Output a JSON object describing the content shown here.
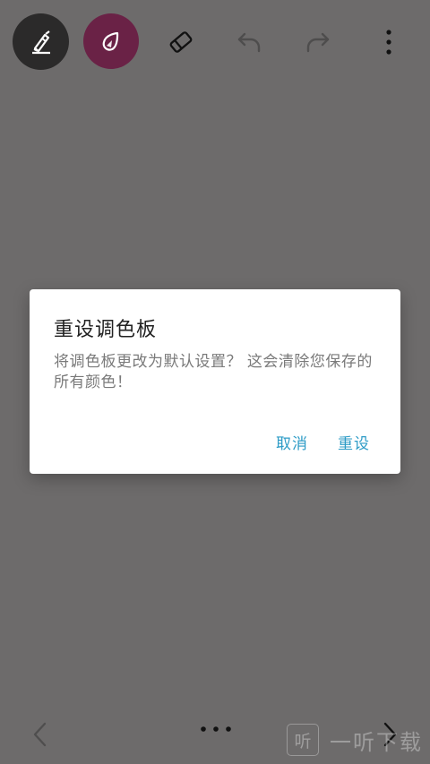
{
  "toolbar": {
    "tools": [
      {
        "name": "pen",
        "icon": "pen-icon",
        "color": "#2b2a2a"
      },
      {
        "name": "color",
        "icon": "droplet-icon",
        "color": "#6a2246"
      },
      {
        "name": "eraser",
        "icon": "eraser-icon"
      },
      {
        "name": "undo",
        "icon": "undo-icon"
      },
      {
        "name": "redo",
        "icon": "redo-icon"
      },
      {
        "name": "more",
        "icon": "more-vertical-icon"
      }
    ]
  },
  "dialog": {
    "title": "重设调色板",
    "message": "将调色板更改为默认设置？ 这会清除您保存的所有颜色！",
    "cancel_label": "取消",
    "reset_label": "重设",
    "accent_color": "#2c9bc6"
  },
  "bottom_nav": {
    "prev_icon": "chevron-left-icon",
    "dots_icon": "more-horizontal-icon",
    "next_icon": "chevron-right-icon"
  },
  "watermark": {
    "logo_char": "听",
    "text": "一听下载"
  }
}
